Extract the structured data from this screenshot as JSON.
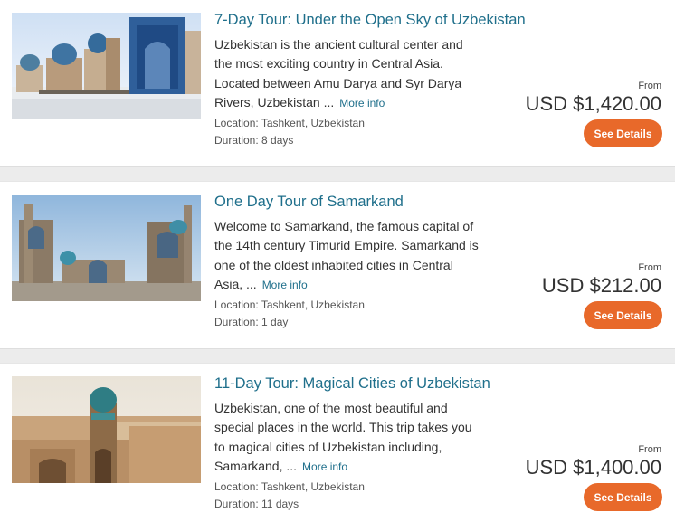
{
  "tours": [
    {
      "title": "7-Day Tour: Under the Open Sky of Uzbekistan",
      "description": "Uzbekistan is the ancient cultural center and the most exciting country in Central Asia. Located between Amu Darya and Syr Darya Rivers, Uzbekistan ...",
      "more_label": "More info",
      "location": "Location: Tashkent, Uzbekistan",
      "duration": "Duration: 8 days",
      "from_label": "From",
      "price": "USD $1,420.00",
      "button_label": "See Details",
      "image_icon": "shah-i-zinda-photo"
    },
    {
      "title": "One Day Tour of Samarkand",
      "description": "Welcome to Samarkand, the famous capital of the 14th century Timurid Empire. Samarkand is one of the oldest inhabited cities in Central Asia, ...",
      "more_label": "More info",
      "location": "Location: Tashkent, Uzbekistan",
      "duration": "Duration: 1 day",
      "from_label": "From",
      "price": "USD $212.00",
      "button_label": "See Details",
      "image_icon": "registan-photo"
    },
    {
      "title": "11-Day Tour: Magical Cities of Uzbekistan",
      "description": "Uzbekistan, one of the most beautiful and special places in the world. This trip takes you to magical cities of Uzbekistan including, Samarkand, ...",
      "more_label": "More info",
      "location": "Location: Tashkent, Uzbekistan",
      "duration": "Duration: 11 days",
      "from_label": "From",
      "price": "USD $1,400.00",
      "button_label": "See Details",
      "image_icon": "khiva-minaret-photo"
    }
  ],
  "colors": {
    "title": "#1f6f8b",
    "button": "#e8692a",
    "separator": "#ececec"
  }
}
